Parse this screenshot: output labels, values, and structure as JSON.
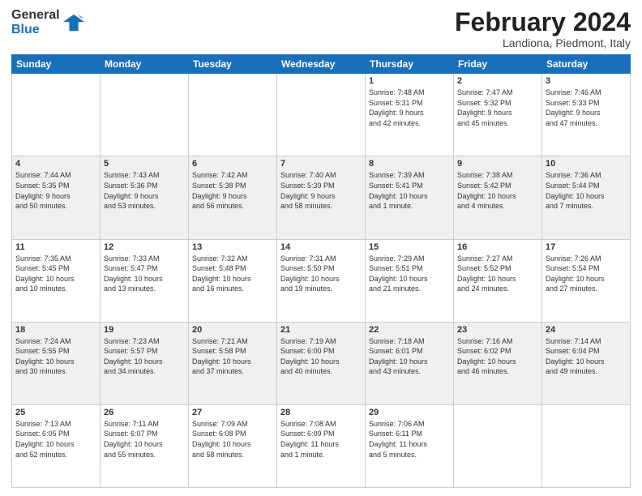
{
  "logo": {
    "general": "General",
    "blue": "Blue"
  },
  "title": {
    "month": "February 2024",
    "location": "Landiona, Piedmont, Italy"
  },
  "days_of_week": [
    "Sunday",
    "Monday",
    "Tuesday",
    "Wednesday",
    "Thursday",
    "Friday",
    "Saturday"
  ],
  "weeks": [
    [
      {
        "day": "",
        "info": ""
      },
      {
        "day": "",
        "info": ""
      },
      {
        "day": "",
        "info": ""
      },
      {
        "day": "",
        "info": ""
      },
      {
        "day": "1",
        "info": "Sunrise: 7:48 AM\nSunset: 5:31 PM\nDaylight: 9 hours\nand 42 minutes."
      },
      {
        "day": "2",
        "info": "Sunrise: 7:47 AM\nSunset: 5:32 PM\nDaylight: 9 hours\nand 45 minutes."
      },
      {
        "day": "3",
        "info": "Sunrise: 7:46 AM\nSunset: 5:33 PM\nDaylight: 9 hours\nand 47 minutes."
      }
    ],
    [
      {
        "day": "4",
        "info": "Sunrise: 7:44 AM\nSunset: 5:35 PM\nDaylight: 9 hours\nand 50 minutes."
      },
      {
        "day": "5",
        "info": "Sunrise: 7:43 AM\nSunset: 5:36 PM\nDaylight: 9 hours\nand 53 minutes."
      },
      {
        "day": "6",
        "info": "Sunrise: 7:42 AM\nSunset: 5:38 PM\nDaylight: 9 hours\nand 56 minutes."
      },
      {
        "day": "7",
        "info": "Sunrise: 7:40 AM\nSunset: 5:39 PM\nDaylight: 9 hours\nand 58 minutes."
      },
      {
        "day": "8",
        "info": "Sunrise: 7:39 AM\nSunset: 5:41 PM\nDaylight: 10 hours\nand 1 minute."
      },
      {
        "day": "9",
        "info": "Sunrise: 7:38 AM\nSunset: 5:42 PM\nDaylight: 10 hours\nand 4 minutes."
      },
      {
        "day": "10",
        "info": "Sunrise: 7:36 AM\nSunset: 5:44 PM\nDaylight: 10 hours\nand 7 minutes."
      }
    ],
    [
      {
        "day": "11",
        "info": "Sunrise: 7:35 AM\nSunset: 5:45 PM\nDaylight: 10 hours\nand 10 minutes."
      },
      {
        "day": "12",
        "info": "Sunrise: 7:33 AM\nSunset: 5:47 PM\nDaylight: 10 hours\nand 13 minutes."
      },
      {
        "day": "13",
        "info": "Sunrise: 7:32 AM\nSunset: 5:48 PM\nDaylight: 10 hours\nand 16 minutes."
      },
      {
        "day": "14",
        "info": "Sunrise: 7:31 AM\nSunset: 5:50 PM\nDaylight: 10 hours\nand 19 minutes."
      },
      {
        "day": "15",
        "info": "Sunrise: 7:29 AM\nSunset: 5:51 PM\nDaylight: 10 hours\nand 21 minutes."
      },
      {
        "day": "16",
        "info": "Sunrise: 7:27 AM\nSunset: 5:52 PM\nDaylight: 10 hours\nand 24 minutes."
      },
      {
        "day": "17",
        "info": "Sunrise: 7:26 AM\nSunset: 5:54 PM\nDaylight: 10 hours\nand 27 minutes."
      }
    ],
    [
      {
        "day": "18",
        "info": "Sunrise: 7:24 AM\nSunset: 5:55 PM\nDaylight: 10 hours\nand 30 minutes."
      },
      {
        "day": "19",
        "info": "Sunrise: 7:23 AM\nSunset: 5:57 PM\nDaylight: 10 hours\nand 34 minutes."
      },
      {
        "day": "20",
        "info": "Sunrise: 7:21 AM\nSunset: 5:58 PM\nDaylight: 10 hours\nand 37 minutes."
      },
      {
        "day": "21",
        "info": "Sunrise: 7:19 AM\nSunset: 6:00 PM\nDaylight: 10 hours\nand 40 minutes."
      },
      {
        "day": "22",
        "info": "Sunrise: 7:18 AM\nSunset: 6:01 PM\nDaylight: 10 hours\nand 43 minutes."
      },
      {
        "day": "23",
        "info": "Sunrise: 7:16 AM\nSunset: 6:02 PM\nDaylight: 10 hours\nand 46 minutes."
      },
      {
        "day": "24",
        "info": "Sunrise: 7:14 AM\nSunset: 6:04 PM\nDaylight: 10 hours\nand 49 minutes."
      }
    ],
    [
      {
        "day": "25",
        "info": "Sunrise: 7:13 AM\nSunset: 6:05 PM\nDaylight: 10 hours\nand 52 minutes."
      },
      {
        "day": "26",
        "info": "Sunrise: 7:11 AM\nSunset: 6:07 PM\nDaylight: 10 hours\nand 55 minutes."
      },
      {
        "day": "27",
        "info": "Sunrise: 7:09 AM\nSunset: 6:08 PM\nDaylight: 10 hours\nand 58 minutes."
      },
      {
        "day": "28",
        "info": "Sunrise: 7:08 AM\nSunset: 6:09 PM\nDaylight: 11 hours\nand 1 minute."
      },
      {
        "day": "29",
        "info": "Sunrise: 7:06 AM\nSunset: 6:11 PM\nDaylight: 11 hours\nand 5 minutes."
      },
      {
        "day": "",
        "info": ""
      },
      {
        "day": "",
        "info": ""
      }
    ]
  ]
}
